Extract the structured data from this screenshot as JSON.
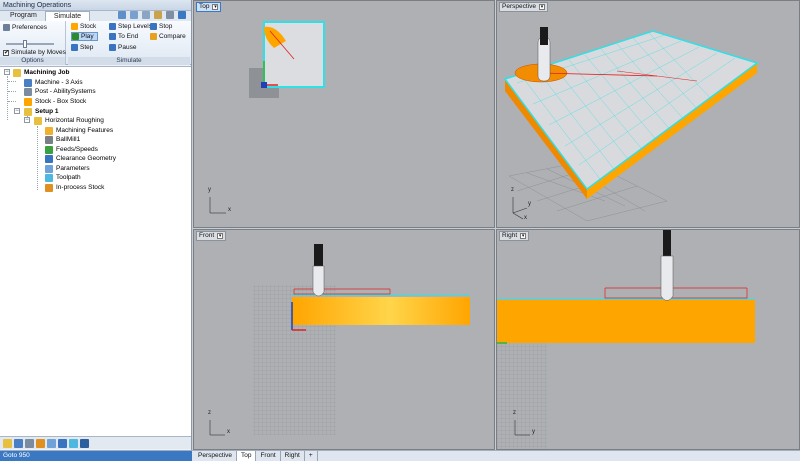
{
  "window": {
    "title": "Machining Operations"
  },
  "tabs": [
    {
      "label": "Program"
    },
    {
      "label": "Simulate"
    }
  ],
  "ribbon": {
    "preferences_label": "Preferences",
    "simulate_by_moves_label": "Simulate by Moves",
    "simulate_by_moves_checked": "✔",
    "options_caption": "Options",
    "stock_label": "Stock",
    "play_label": "Play",
    "step_label": "Step",
    "step_levels_label": "Step Levels",
    "to_end_label": "To End",
    "pause_label": "Pause",
    "stop_label": "Stop",
    "compare_label": "Compare",
    "simulate_caption": "Simulate"
  },
  "tree": {
    "items": [
      {
        "label": "Machining Job",
        "icon": "job-folder-icon"
      },
      {
        "label": "Machine - 3 Axis",
        "icon": "machine-icon"
      },
      {
        "label": "Post - AbilitySystems",
        "icon": "post-icon"
      },
      {
        "label": "Stock - Box Stock",
        "icon": "stock-icon"
      },
      {
        "label": "Setup 1",
        "icon": "setup-folder-icon"
      },
      {
        "label": "Horizontal Roughing",
        "icon": "operation-folder-icon"
      },
      {
        "label": "Machining Features",
        "icon": "features-icon"
      },
      {
        "label": "BallMill1",
        "icon": "ballmill-icon"
      },
      {
        "label": "Feeds/Speeds",
        "icon": "feeds-icon"
      },
      {
        "label": "Clearance Geometry",
        "icon": "clearance-icon"
      },
      {
        "label": "Parameters",
        "icon": "parameters-icon"
      },
      {
        "label": "Toolpath",
        "icon": "toolpath-icon"
      },
      {
        "label": "In-process Stock",
        "icon": "inprocess-stock-icon"
      }
    ]
  },
  "status": {
    "text": "Goto 950"
  },
  "viewport_tabs": [
    {
      "label": "Perspective"
    },
    {
      "label": "Top"
    },
    {
      "label": "Front"
    },
    {
      "label": "Right"
    },
    {
      "label": "+"
    }
  ],
  "viewports": {
    "top": {
      "label": "Top"
    },
    "perspective": {
      "label": "Perspective"
    },
    "front": {
      "label": "Front"
    },
    "right": {
      "label": "Right"
    }
  },
  "axes": {
    "top": {
      "x": "x",
      "y": "y"
    },
    "perspective": {
      "x": "x",
      "y": "y",
      "z": "z"
    },
    "front": {
      "x": "x",
      "z": "z"
    },
    "right": {
      "y": "y",
      "z": "z"
    }
  },
  "colors": {
    "stock": "#ffa500",
    "stock_highlight": "#ffd54a",
    "wireframe": "#2ee0e8",
    "toolpath": "#e02020",
    "viewport_bg": "#aeb0b3"
  }
}
